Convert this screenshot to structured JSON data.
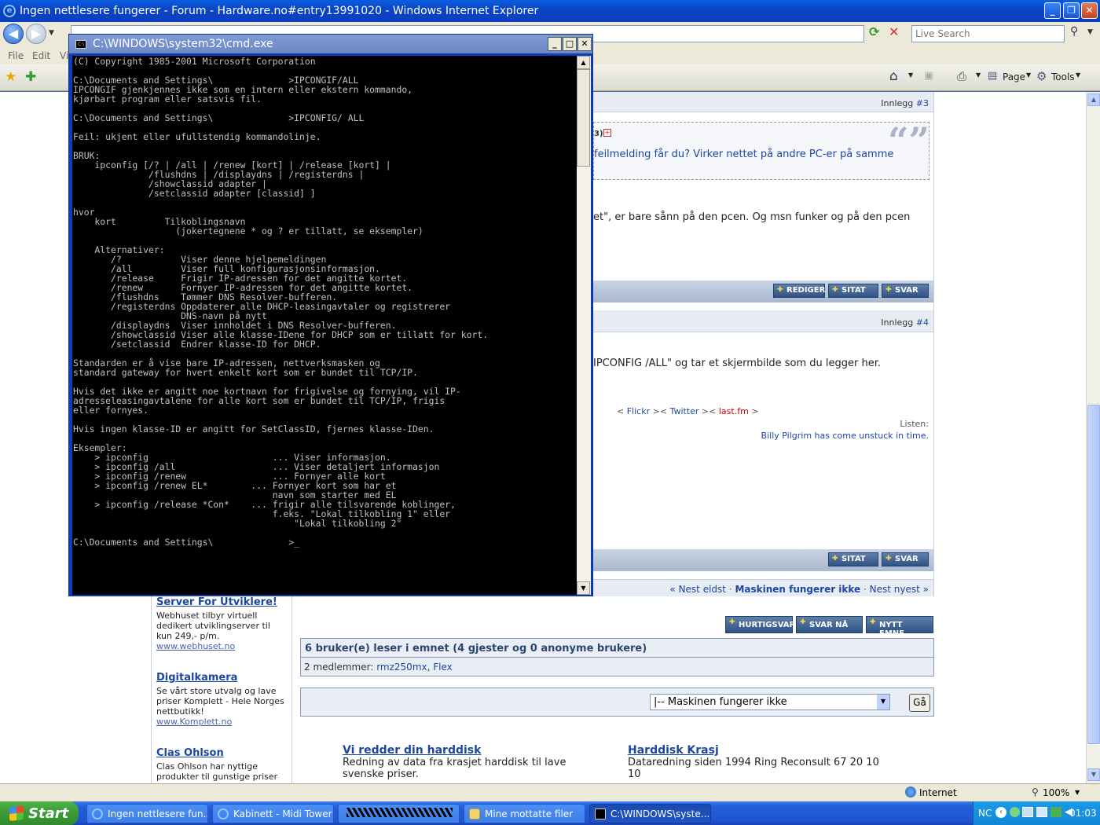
{
  "ie": {
    "title": "Ingen nettlesere fungerer - Forum - Hardware.no#entry13991020 - Windows Internet Explorer",
    "search_placeholder": "Live Search",
    "menu": [
      "File",
      "Edit",
      "Vi"
    ],
    "toolbar": {
      "page": "Page",
      "tools": "Tools"
    }
  },
  "forum": {
    "post3": {
      "number_prefix": "Innlegg ",
      "number": "#3",
      "quote_text": " feilmelding får du? Virker nettet på andre PC-er på samme",
      "body_text": "et\", er bare sånn på den pcen. Og msn funker og på den pcen"
    },
    "post4": {
      "number_prefix": "Innlegg ",
      "number": "#4",
      "body_text": "IPCONFIG /ALL\" og tar et skjermbilde som du legger her.",
      "links": {
        "lt": "< ",
        "flickr": "Flickr",
        "sep1": " >< ",
        "twitter": "Twitter",
        "sep2": " >< ",
        "lastfm": "last.fm",
        "gt": " >"
      },
      "signature_label": "Listen:",
      "signature_text": "Billy Pilgrim has come unstuck in time."
    },
    "buttons": {
      "rediger": "REDIGER",
      "sitat": "SITAT",
      "svar": "SVAR"
    },
    "thread_nav": {
      "prev": "« Nest eldst",
      "sep": " · ",
      "title": "Maskinen fungerer ikke",
      "next": "Nest nyest »"
    },
    "reply_buttons": {
      "hurtigsvar": "HURTIGSVAR",
      "svar_na": "SVAR NÅ",
      "nytt_emne": "NYTT EMNE"
    },
    "readers_title": "6 bruker(e) leser i emnet (4 gjester og 0 anonyme brukere)",
    "readers_members_label": "2 medlemmer: ",
    "readers_members": [
      "rmz250mx",
      "Flex"
    ],
    "jump_select": "|-- Maskinen fungerer ikke",
    "jump_go": "Gå"
  },
  "sidebar_ads": [
    {
      "title": "Server For Utviklere!",
      "text": "Webhuset tilbyr virtuell dedikert utviklingserver til kun 249,- p/m.",
      "url": "www.webhuset.no"
    },
    {
      "title": "Digitalkamera",
      "text": "Se vårt store utvalg og lave priser Komplett - Hele Norges nettbutikk!",
      "url": "www.Komplett.no"
    },
    {
      "title": "Clas Ohlson",
      "text": "Clas Ohlson har nyttige produkter til gunstige priser",
      "url": ""
    }
  ],
  "bottom_ads": [
    {
      "title": "Vi redder din harddisk",
      "text": "Redning av data fra krasjet harddisk til lave svenske priser."
    },
    {
      "title": "Harddisk Krasj",
      "text": "Dataredning siden 1994 Ring Reconsult 67 20 10 10"
    }
  ],
  "cmd": {
    "title": "C:\\WINDOWS\\system32\\cmd.exe",
    "lines": [
      "(C) Copyright 1985-2001 Microsoft Corporation",
      "",
      "C:\\Documents and Settings\\              >IPCONGIF/ALL",
      "IPCONGIF gjenkjennes ikke som en intern eller ekstern kommando,",
      "kjørbart program eller satsvis fil.",
      "",
      "C:\\Documents and Settings\\              >IPCONFIG/ ALL",
      "",
      "Feil: ukjent eller ufullstendig kommandolinje.",
      "",
      "BRUK:",
      "    ipconfig [/? | /all | /renew [kort] | /release [kort] |",
      "              /flushdns | /displaydns | /registerdns |",
      "              /showclassid adapter |",
      "              /setclassid adapter [classid] ]",
      "",
      "hvor",
      "    kort         Tilkoblingsnavn",
      "                   (jokertegnene * og ? er tillatt, se eksempler)",
      "",
      "    Alternativer:",
      "       /?           Viser denne hjelpemeldingen",
      "       /all         Viser full konfigurasjonsinformasjon.",
      "       /release     Frigir IP-adressen for det angitte kortet.",
      "       /renew       Fornyer IP-adressen for det angitte kortet.",
      "       /flushdns    Tømmer DNS Resolver-bufferen.",
      "       /registerdns Oppdaterer alle DHCP-leasingavtaler og registrerer",
      "                    DNS-navn på nytt",
      "       /displaydns  Viser innholdet i DNS Resolver-bufferen.",
      "       /showclassid Viser alle klasse-IDene for DHCP som er tillatt for kort.",
      "       /setclassid  Endrer klasse-ID for DHCP.",
      "",
      "Standarden er å vise bare IP-adressen, nettverksmasken og",
      "standard gateway for hvert enkelt kort som er bundet til TCP/IP.",
      "",
      "Hvis det ikke er angitt noe kortnavn for frigivelse og fornying, vil IP-",
      "adresseleasingavtalene for alle kort som er bundet til TCP/IP, frigis",
      "eller fornyes.",
      "",
      "Hvis ingen klasse-ID er angitt for SetClassID, fjernes klasse-IDen.",
      "",
      "Eksempler:",
      "    > ipconfig                       ... Viser informasjon.",
      "    > ipconfig /all                  ... Viser detaljert informasjon",
      "    > ipconfig /renew                ... Fornyer alle kort",
      "    > ipconfig /renew EL*        ... Fornyer kort som har et",
      "                                     navn som starter med EL",
      "    > ipconfig /release *Con*    ... frigir alle tilsvarende koblinger,",
      "                                     f.eks. \"Lokal tilkobling 1\" eller",
      "                                         \"Lokal tilkobling 2\"",
      "",
      "C:\\Documents and Settings\\              >_"
    ]
  },
  "statusbar": {
    "zone": "Internet",
    "zoom": "100%"
  },
  "taskbar": {
    "start": "Start",
    "tasks": [
      "Ingen nettlesere fun...",
      "Kabinett - Midi Tower ...",
      "",
      "Mine mottatte filer",
      "C:\\WINDOWS\\syste..."
    ],
    "lang": "NC",
    "clock": "01:03"
  }
}
